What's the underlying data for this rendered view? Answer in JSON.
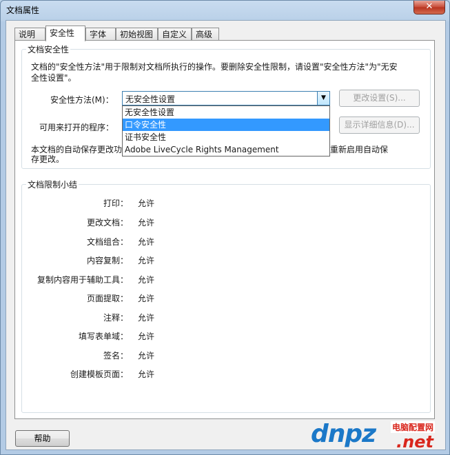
{
  "window": {
    "title": "文档属性",
    "close_glyph": "✕"
  },
  "tabs": [
    {
      "label": "说明",
      "active": false
    },
    {
      "label": "安全性",
      "active": true
    },
    {
      "label": "字体",
      "active": false
    },
    {
      "label": "初始视图",
      "active": false
    },
    {
      "label": "自定义",
      "active": false
    },
    {
      "label": "高级",
      "active": false
    }
  ],
  "security": {
    "group_title": "文档安全性",
    "description": "文档的\"安全性方法\"用于限制对文档所执行的操作。要删除安全性限制，请设置\"安全性方法\"为\"无安全性设置\"。",
    "method_label": "安全性方法(M)：",
    "method_value": "无安全性设置",
    "dropdown_options": [
      {
        "label": "无安全性设置",
        "selected": false
      },
      {
        "label": "口令安全性",
        "selected": true
      },
      {
        "label": "证书安全性",
        "selected": false
      },
      {
        "label": "Adobe LiveCycle Rights Management",
        "selected": false
      }
    ],
    "change_settings_button": "更改设置(S)...",
    "open_with_label": "可用来打开的程序：",
    "show_details_button": "显示详细信息(D)...",
    "autosave_text_left": "本文档的自动保存更改功",
    "autosave_text_right": "重新启用自动保",
    "autosave_text_line2": "存更改。"
  },
  "restrictions": {
    "group_title": "文档限制小结",
    "rows": [
      {
        "label": "打印：",
        "value": "允许"
      },
      {
        "label": "更改文档：",
        "value": "允许"
      },
      {
        "label": "文档组合：",
        "value": "允许"
      },
      {
        "label": "内容复制：",
        "value": "允许"
      },
      {
        "label": "复制内容用于辅助工具：",
        "value": "允许"
      },
      {
        "label": "页面提取：",
        "value": "允许"
      },
      {
        "label": "注释：",
        "value": "允许"
      },
      {
        "label": "填写表单域：",
        "value": "允许"
      },
      {
        "label": "签名：",
        "value": "允许"
      },
      {
        "label": "创建模板页面：",
        "value": "允许"
      }
    ]
  },
  "footer": {
    "help_button": "帮助"
  },
  "watermark": {
    "logo_text": "dnpz",
    "site_name": "电脑配置网",
    "domain_suffix": ".net"
  }
}
